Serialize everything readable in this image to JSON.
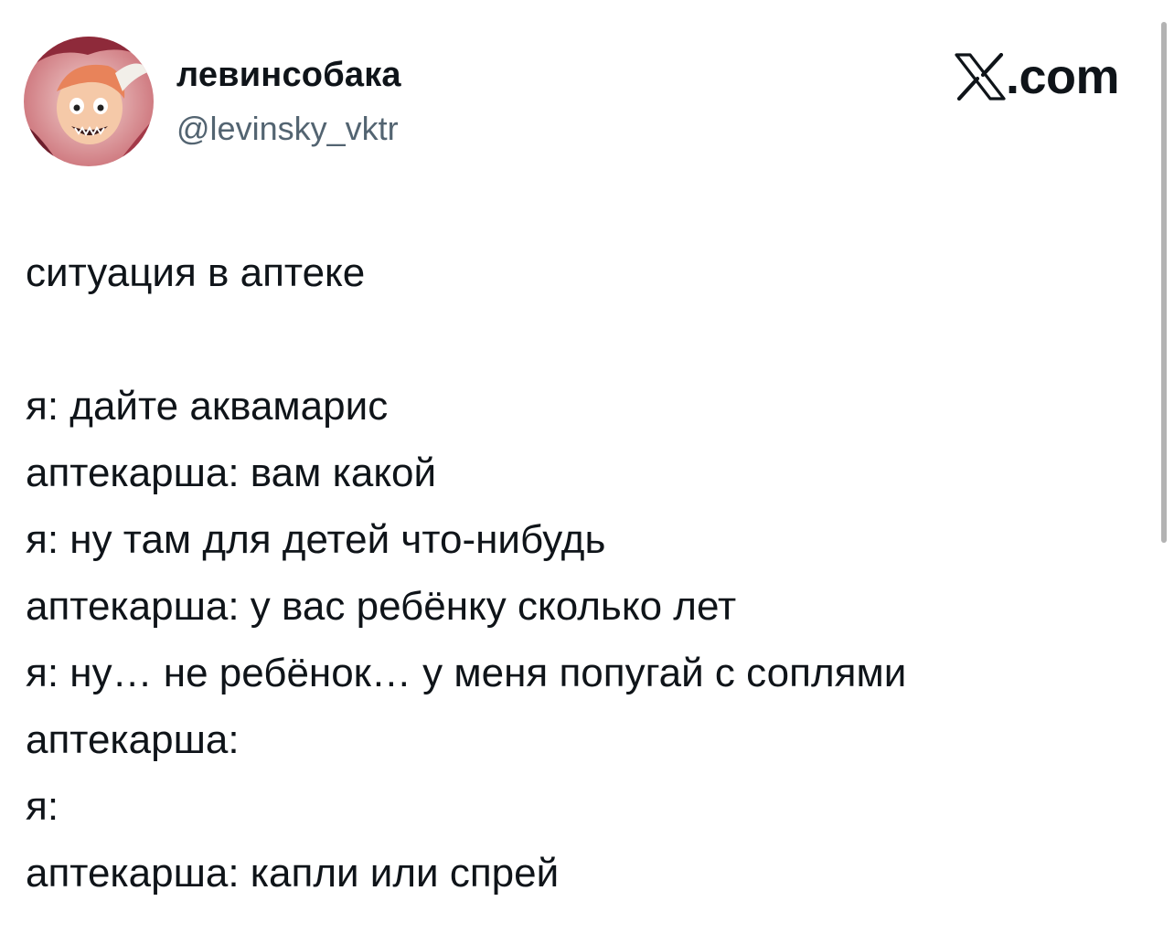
{
  "author": {
    "display_name": "левинсобака",
    "handle": "@levinsky_vktr",
    "avatar_icon": "profile-avatar"
  },
  "brand": {
    "logo_icon": "x-logo-icon",
    "suffix": ".com"
  },
  "tweet": {
    "title_line": "ситуация в аптеке",
    "lines": [
      "я: дайте аквамарис",
      "аптекарша: вам какой",
      "я: ну там для детей что-нибудь",
      "аптекарша: у вас ребёнку сколько лет",
      "я: ну… не ребёнок… у меня попугай с соплями",
      "аптекарша:",
      "я:",
      "аптекарша: капли или спрей"
    ]
  },
  "colors": {
    "text": "#0f1419",
    "secondary": "#536471",
    "background": "#ffffff"
  }
}
